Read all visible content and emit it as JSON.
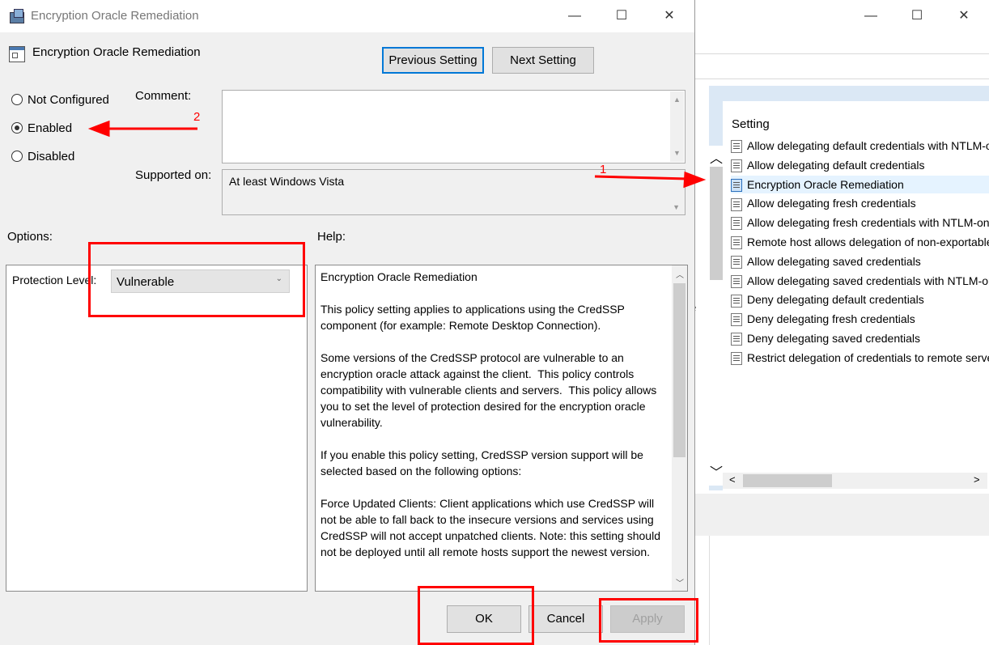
{
  "background_window": {
    "controls": {
      "minimize": "—",
      "maximize": "☐",
      "close": "✕"
    },
    "list_header": "Setting",
    "items": [
      {
        "label": "Allow delegating default credentials with NTLM-only server authentication",
        "selected": false
      },
      {
        "label": "Allow delegating default credentials",
        "selected": false
      },
      {
        "label": "Encryption Oracle Remediation",
        "selected": true
      },
      {
        "label": "Allow delegating fresh credentials",
        "selected": false
      },
      {
        "label": "Allow delegating fresh credentials with NTLM-only server authentication",
        "selected": false
      },
      {
        "label": "Remote host allows delegation of non-exportable credentials",
        "selected": false
      },
      {
        "label": "Allow delegating saved credentials",
        "selected": false
      },
      {
        "label": "Allow delegating saved credentials with NTLM-only server authentication",
        "selected": false
      },
      {
        "label": "Deny delegating default credentials",
        "selected": false
      },
      {
        "label": "Deny delegating fresh credentials",
        "selected": false
      },
      {
        "label": "Deny delegating saved credentials",
        "selected": false
      },
      {
        "label": "Restrict delegation of credentials to remote servers",
        "selected": false
      }
    ],
    "scroll_up": "︿",
    "scroll_down": "﹀",
    "scroll_left": "<",
    "scroll_right": ">",
    "partial_letter": "e"
  },
  "dialog": {
    "window_title": "Encryption Oracle Remediation",
    "controls": {
      "minimize": "—",
      "maximize": "☐",
      "close": "✕"
    },
    "policy_name": "Encryption Oracle Remediation",
    "previous_setting": "Previous Setting",
    "next_setting": "Next Setting",
    "radios": [
      {
        "label": "Not Configured",
        "checked": false
      },
      {
        "label": "Enabled",
        "checked": true
      },
      {
        "label": "Disabled",
        "checked": false
      }
    ],
    "comment_label": "Comment:",
    "supported_label": "Supported on:",
    "supported_value": "At least Windows Vista",
    "options_label": "Options:",
    "help_label": "Help:",
    "protection_label": "Protection Level:",
    "protection_value": "Vulnerable",
    "help_text": "Encryption Oracle Remediation\n\nThis policy setting applies to applications using the CredSSP component (for example: Remote Desktop Connection).\n\nSome versions of the CredSSP protocol are vulnerable to an encryption oracle attack against the client.  This policy controls compatibility with vulnerable clients and servers.  This policy allows you to set the level of protection desired for the encryption oracle vulnerability.\n\nIf you enable this policy setting, CredSSP version support will be selected based on the following options:\n\nForce Updated Clients: Client applications which use CredSSP will not be able to fall back to the insecure versions and services using CredSSP will not accept unpatched clients. Note: this setting should not be deployed until all remote hosts support the newest version.",
    "ok": "OK",
    "cancel": "Cancel",
    "apply": "Apply"
  },
  "annotations": {
    "step1": "1",
    "step2": "2",
    "color": "#ff0000"
  }
}
